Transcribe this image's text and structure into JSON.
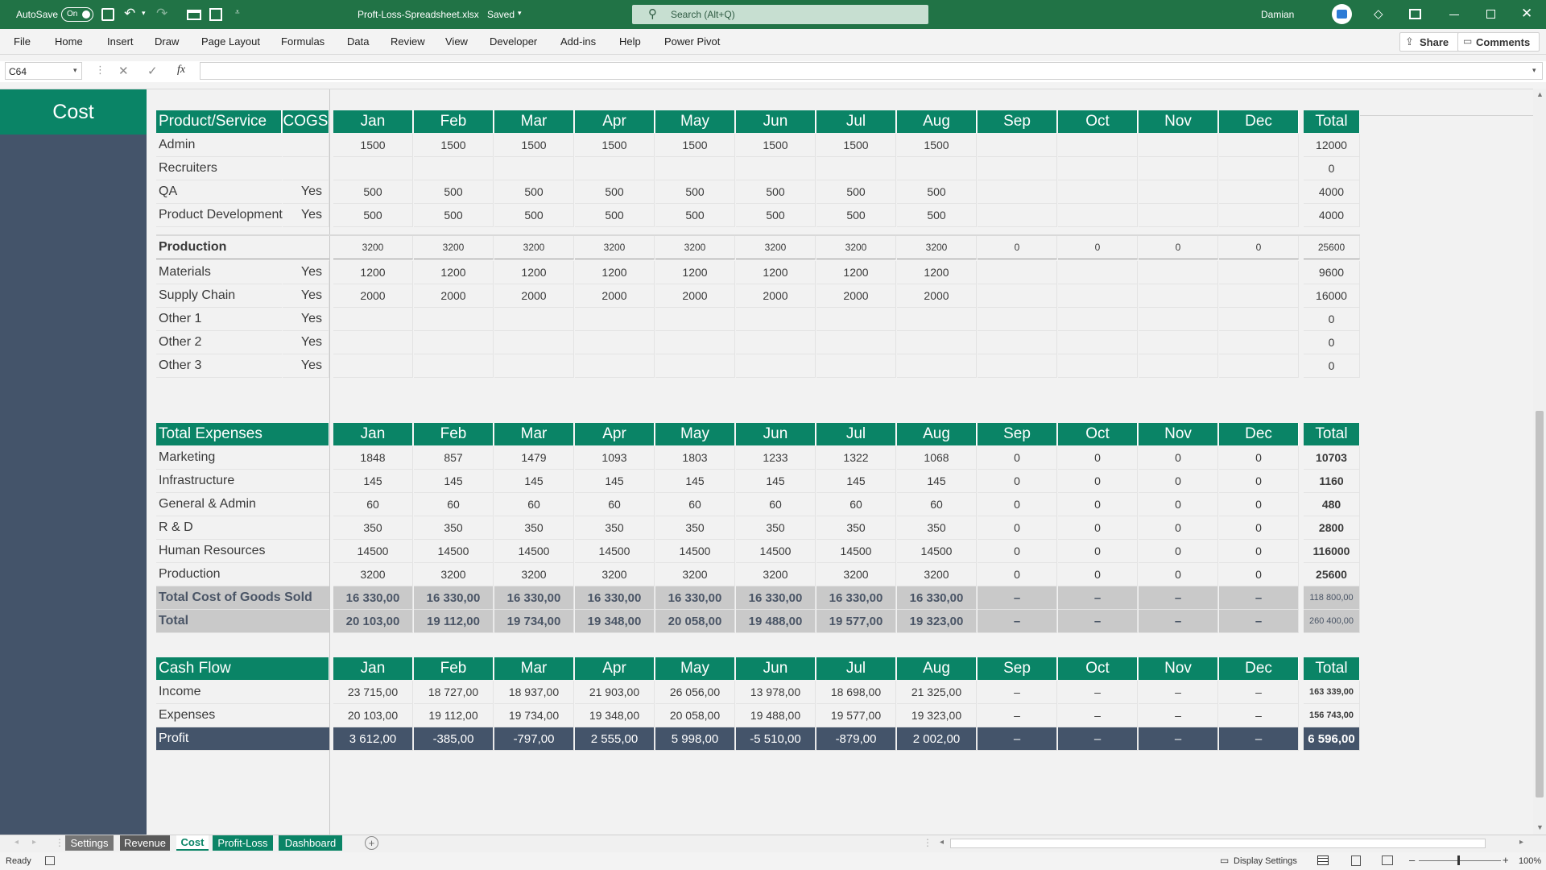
{
  "app": {
    "autosave_label": "AutoSave",
    "autosave_state": "On",
    "file_title": "Proft-Loss-Spreadsheet.xlsx",
    "save_status": "Saved",
    "search_placeholder": "Search (Alt+Q)",
    "user": "Damian",
    "accent": "#217346"
  },
  "ribbon": {
    "tabs": [
      "File",
      "Home",
      "Insert",
      "Draw",
      "Page Layout",
      "Formulas",
      "Data",
      "Review",
      "View",
      "Developer",
      "Add-ins",
      "Help",
      "Power Pivot"
    ],
    "share_label": "Share",
    "comments_label": "Comments"
  },
  "formula_bar": {
    "name_box": "C64",
    "fx": "fx",
    "formula": ""
  },
  "sheet": {
    "title": "Cost",
    "months": [
      "Jan",
      "Feb",
      "Mar",
      "Apr",
      "May",
      "Jun",
      "Jul",
      "Aug",
      "Sep",
      "Oct",
      "Nov",
      "Dec"
    ],
    "total_label": "Total",
    "cost_table": {
      "header_label": "Product/Service",
      "cogs_label": "COGS",
      "rows": [
        {
          "label": "Admin",
          "cogs": "",
          "values": [
            "1500",
            "1500",
            "1500",
            "1500",
            "1500",
            "1500",
            "1500",
            "1500",
            "",
            "",
            "",
            ""
          ],
          "total": "12000"
        },
        {
          "label": "Recruiters",
          "cogs": "",
          "values": [
            "",
            "",
            "",
            "",
            "",
            "",
            "",
            "",
            "",
            "",
            "",
            ""
          ],
          "total": "0"
        },
        {
          "label": "QA",
          "cogs": "Yes",
          "values": [
            "500",
            "500",
            "500",
            "500",
            "500",
            "500",
            "500",
            "500",
            "",
            "",
            "",
            ""
          ],
          "total": "4000"
        },
        {
          "label": "Product Development",
          "cogs": "Yes",
          "values": [
            "500",
            "500",
            "500",
            "500",
            "500",
            "500",
            "500",
            "500",
            "",
            "",
            "",
            ""
          ],
          "total": "4000"
        }
      ],
      "section": {
        "label": "Production",
        "values": [
          "3200",
          "3200",
          "3200",
          "3200",
          "3200",
          "3200",
          "3200",
          "3200",
          "0",
          "0",
          "0",
          "0"
        ],
        "total": "25600"
      },
      "section_rows": [
        {
          "label": "Materials",
          "cogs": "Yes",
          "values": [
            "1200",
            "1200",
            "1200",
            "1200",
            "1200",
            "1200",
            "1200",
            "1200",
            "",
            "",
            "",
            ""
          ],
          "total": "9600"
        },
        {
          "label": "Supply Chain",
          "cogs": "Yes",
          "values": [
            "2000",
            "2000",
            "2000",
            "2000",
            "2000",
            "2000",
            "2000",
            "2000",
            "",
            "",
            "",
            ""
          ],
          "total": "16000"
        },
        {
          "label": "Other 1",
          "cogs": "Yes",
          "values": [
            "",
            "",
            "",
            "",
            "",
            "",
            "",
            "",
            "",
            "",
            "",
            ""
          ],
          "total": "0"
        },
        {
          "label": "Other 2",
          "cogs": "Yes",
          "values": [
            "",
            "",
            "",
            "",
            "",
            "",
            "",
            "",
            "",
            "",
            "",
            ""
          ],
          "total": "0"
        },
        {
          "label": "Other 3",
          "cogs": "Yes",
          "values": [
            "",
            "",
            "",
            "",
            "",
            "",
            "",
            "",
            "",
            "",
            "",
            ""
          ],
          "total": "0"
        }
      ]
    },
    "expenses_table": {
      "header_label": "Total Expenses",
      "rows": [
        {
          "label": "Marketing",
          "values": [
            "1848",
            "857",
            "1479",
            "1093",
            "1803",
            "1233",
            "1322",
            "1068",
            "0",
            "0",
            "0",
            "0"
          ],
          "total": "10703"
        },
        {
          "label": "Infrastructure",
          "values": [
            "145",
            "145",
            "145",
            "145",
            "145",
            "145",
            "145",
            "145",
            "0",
            "0",
            "0",
            "0"
          ],
          "total": "1160"
        },
        {
          "label": "General & Admin",
          "values": [
            "60",
            "60",
            "60",
            "60",
            "60",
            "60",
            "60",
            "60",
            "0",
            "0",
            "0",
            "0"
          ],
          "total": "480"
        },
        {
          "label": "R & D",
          "values": [
            "350",
            "350",
            "350",
            "350",
            "350",
            "350",
            "350",
            "350",
            "0",
            "0",
            "0",
            "0"
          ],
          "total": "2800"
        },
        {
          "label": "Human Resources",
          "values": [
            "14500",
            "14500",
            "14500",
            "14500",
            "14500",
            "14500",
            "14500",
            "14500",
            "0",
            "0",
            "0",
            "0"
          ],
          "total": "116000"
        },
        {
          "label": "Production",
          "values": [
            "3200",
            "3200",
            "3200",
            "3200",
            "3200",
            "3200",
            "3200",
            "3200",
            "0",
            "0",
            "0",
            "0"
          ],
          "total": "25600"
        }
      ],
      "summary_rows": [
        {
          "label": "Total Cost of Goods Sold",
          "values": [
            "16 330,00",
            "16 330,00",
            "16 330,00",
            "16 330,00",
            "16 330,00",
            "16 330,00",
            "16 330,00",
            "16 330,00",
            "–",
            "–",
            "–",
            "–"
          ],
          "total": "118 800,00"
        },
        {
          "label": "Total",
          "values": [
            "20 103,00",
            "19 112,00",
            "19 734,00",
            "19 348,00",
            "20 058,00",
            "19 488,00",
            "19 577,00",
            "19 323,00",
            "–",
            "–",
            "–",
            "–"
          ],
          "total": "260 400,00"
        }
      ]
    },
    "cashflow_table": {
      "header_label": "Cash Flow",
      "rows": [
        {
          "label": "Income",
          "values": [
            "23 715,00",
            "18 727,00",
            "18 937,00",
            "21 903,00",
            "26 056,00",
            "13 978,00",
            "18 698,00",
            "21 325,00",
            "–",
            "–",
            "–",
            "–"
          ],
          "total": "163 339,00"
        },
        {
          "label": "Expenses",
          "values": [
            "20 103,00",
            "19 112,00",
            "19 734,00",
            "19 348,00",
            "20 058,00",
            "19 488,00",
            "19 577,00",
            "19 323,00",
            "–",
            "–",
            "–",
            "–"
          ],
          "total": "156 743,00"
        }
      ],
      "profit_row": {
        "label": "Profit",
        "values": [
          "3 612,00",
          "-385,00",
          "-797,00",
          "2 555,00",
          "5 998,00",
          "-5 510,00",
          "-879,00",
          "2 002,00",
          "–",
          "–",
          "–",
          "–"
        ],
        "total": "6 596,00"
      }
    }
  },
  "sheet_tabs": [
    {
      "label": "Settings",
      "bg": "#767676",
      "fg": "#ffffff"
    },
    {
      "label": "Revenue",
      "bg": "#5a5a5a",
      "fg": "#ffffff"
    },
    {
      "label": "Cost",
      "bg": "#ffffff",
      "fg": "#0a8466"
    },
    {
      "label": "Profit-Loss",
      "bg": "#0a8466",
      "fg": "#ffffff"
    },
    {
      "label": "Dashboard",
      "bg": "#0a8466",
      "fg": "#ffffff"
    }
  ],
  "status": {
    "ready": "Ready",
    "display_settings": "Display Settings",
    "zoom": "100%"
  }
}
